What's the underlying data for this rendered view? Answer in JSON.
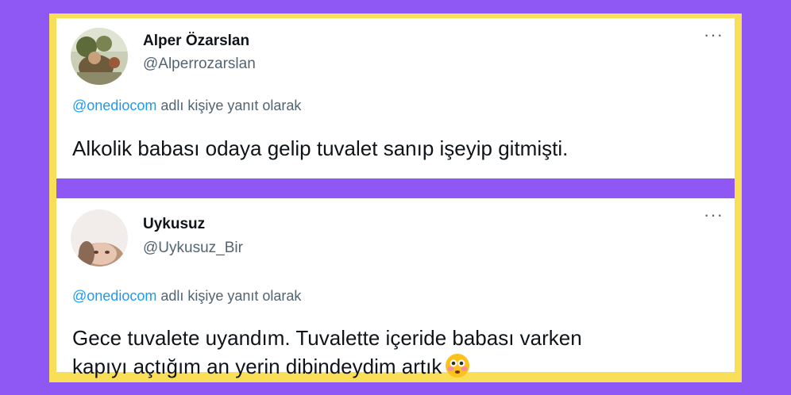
{
  "tweets": [
    {
      "name": "Alper Özarslan",
      "handle": "@Alperrozarslan",
      "more": "···",
      "reply_mention": "@onediocom",
      "reply_suffix": " adlı kişiye yanıt olarak",
      "text": "Alkolik babası odaya gelip tuvalet sanıp işeyip gitmişti.",
      "avatar_icon": "profile-photo-icon"
    },
    {
      "name": "Uykusuz",
      "handle": "@Uykusuz_Bir",
      "more": "···",
      "reply_mention": "@onediocom",
      "reply_suffix": " adlı kişiye yanıt olarak",
      "text_line1": "Gece tuvalete uyandım. Tuvalette içeride babası varken",
      "text_line2": "kapıyı açtığım an yerin dibindeydim artık",
      "emoji_icon": "flushed-face-icon",
      "avatar_icon": "profile-photo-icon"
    }
  ],
  "colors": {
    "background": "#8f57f3",
    "frame": "#f9de58",
    "mention": "#1d9bf0",
    "secondary_text": "#536471",
    "primary_text": "#0f1419"
  }
}
